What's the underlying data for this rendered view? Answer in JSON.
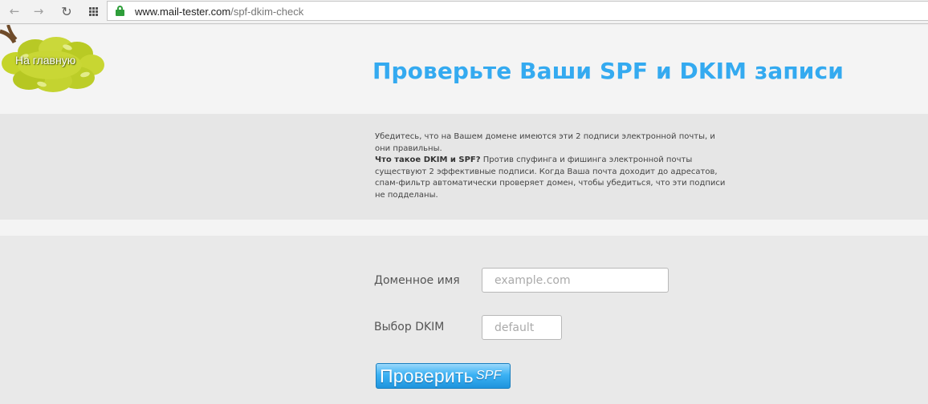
{
  "browser": {
    "url_host": "www.mail-tester.com",
    "url_path": "/spf-dkim-check"
  },
  "header": {
    "home_link": "На главную",
    "title": "Проверьте Ваши SPF и DKIM записи"
  },
  "info": {
    "line1": "Убедитесь, что на Вашем домене имеются эти 2 подписи электронной почты, и они правильны.",
    "question": "Что такое DKIM и SPF?",
    "answer": " Против спуфинга и фишинга электронной почты существуют 2 эффективные подписи. Когда Ваша почта доходит до адресатов, спам-фильтр автоматически проверяет домен, чтобы убедиться, что эти подписи не подделаны."
  },
  "form": {
    "domain_label": "Доменное имя",
    "domain_placeholder": "example.com",
    "domain_value": "",
    "dkim_label": "Выбор DKIM",
    "dkim_placeholder": "default",
    "dkim_value": "",
    "submit_label": "Проверить",
    "submit_suffix": "SPF"
  },
  "colors": {
    "title": "#34aaf0",
    "button": "#3cb2f4",
    "lock": "#2e9e3a",
    "leaves": "#c5d42a"
  }
}
